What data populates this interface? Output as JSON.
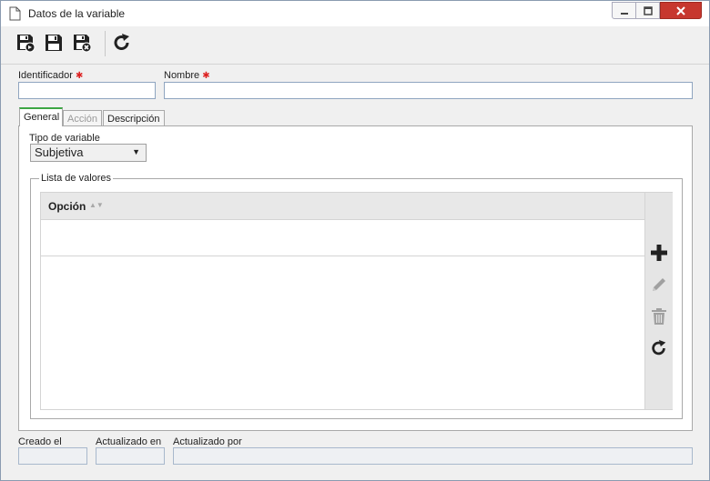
{
  "window": {
    "title": "Datos de la variable",
    "controls": {
      "minimize": "minimize-icon",
      "maximize": "maximize-icon",
      "close": "close-icon"
    }
  },
  "toolbar": {
    "buttons": [
      {
        "icon": "save-and-new-icon",
        "tooltip": ""
      },
      {
        "icon": "save-icon",
        "tooltip": ""
      },
      {
        "icon": "save-and-close-icon",
        "tooltip": ""
      },
      {
        "icon": "refresh-icon",
        "tooltip": ""
      }
    ]
  },
  "form": {
    "identificador": {
      "label": "Identificador",
      "value": "",
      "required": true
    },
    "nombre": {
      "label": "Nombre",
      "value": "",
      "required": true
    }
  },
  "tabs": [
    {
      "label": "General",
      "active": true,
      "enabled": true
    },
    {
      "label": "Acción",
      "active": false,
      "enabled": false
    },
    {
      "label": "Descripción",
      "active": false,
      "enabled": true
    }
  ],
  "general": {
    "tipo_variable": {
      "label": "Tipo de variable",
      "selected": "Subjetiva"
    },
    "lista_valores": {
      "legend": "Lista de valores",
      "columns": [
        "Opción"
      ],
      "rows": [],
      "side_actions": [
        "add-icon",
        "edit-icon",
        "delete-icon",
        "refresh-icon"
      ]
    }
  },
  "footer": {
    "creado_el": {
      "label": "Creado el",
      "value": ""
    },
    "actualizado_en": {
      "label": "Actualizado en",
      "value": ""
    },
    "actualizado_por": {
      "label": "Actualizado por",
      "value": ""
    }
  },
  "colors": {
    "accent_tab": "#3da644",
    "required": "#dd2222",
    "close_button": "#c7372e",
    "disabled_icon": "#a0a0a0",
    "input_border": "#8fa5c0"
  }
}
